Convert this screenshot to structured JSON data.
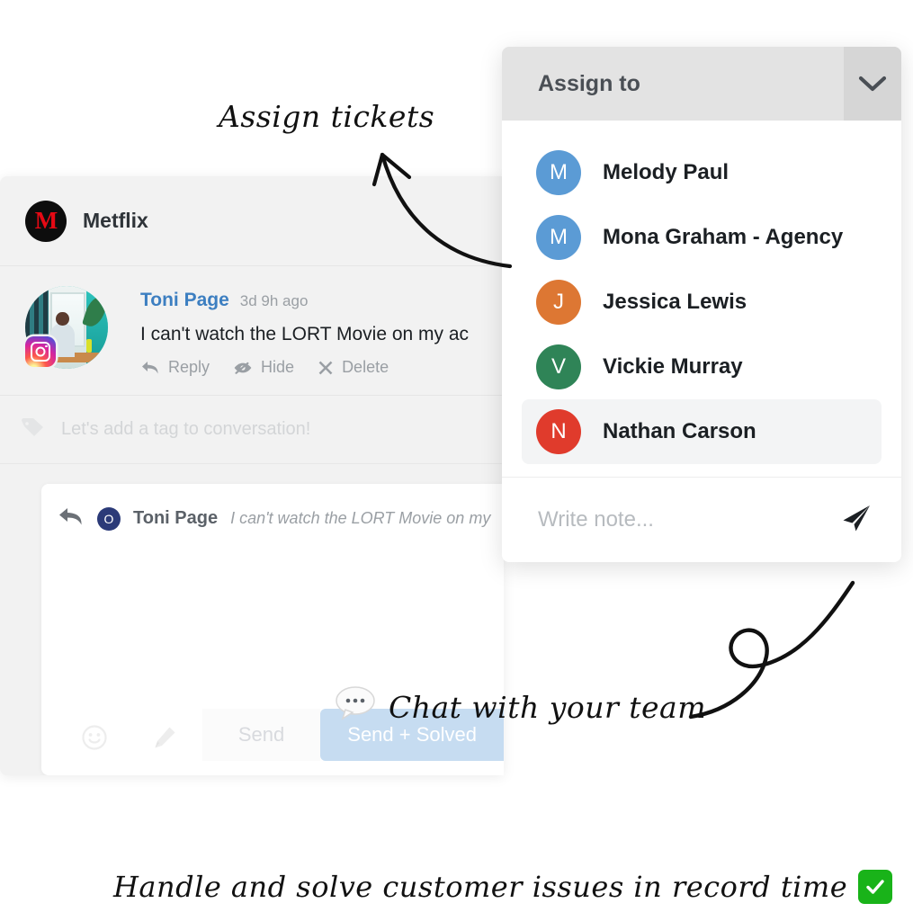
{
  "conversation": {
    "brand": {
      "logo_letter": "M",
      "name": "Metflix",
      "logo_bg": "#0d0d0d",
      "logo_color": "#e50914"
    },
    "message": {
      "author": "Toni Page",
      "author_color": "#3d7fc1",
      "timestamp": "3d 9h ago",
      "text": "I can't watch the LORT Movie on my ac",
      "channel_badge": "instagram-icon",
      "actions": [
        {
          "label": "Reply",
          "icon": "reply-arrow-icon"
        },
        {
          "label": "Hide",
          "icon": "eye-slash-icon"
        },
        {
          "label": "Delete",
          "icon": "x-mark-icon"
        }
      ]
    },
    "tag_row": {
      "icon": "tag-icon",
      "placeholder": "Let's add a tag to conversation!"
    },
    "composer": {
      "quote": {
        "reply_icon": "reply-arrow-icon",
        "avatar_letter": "O",
        "avatar_bg": "#2b3a78",
        "author": "Toni Page",
        "text": "I can't watch the LORT Movie on my "
      },
      "tools": [
        {
          "icon": "emoji-smiley-icon"
        },
        {
          "icon": "pencil-icon"
        }
      ],
      "buttons": {
        "send": "Send",
        "send_solved": "Send + Solved",
        "send_solved_bg": "#c6dcf1"
      }
    }
  },
  "assign_panel": {
    "title": "Assign to",
    "chevron_icon": "chevron-down-icon",
    "header_bg": "#e3e3e3",
    "people": [
      {
        "name": "Melody Paul",
        "initial": "M",
        "color": "#5b9bd5",
        "selected": false
      },
      {
        "name": "Mona Graham - Agency",
        "initial": "M",
        "color": "#5b9bd5",
        "selected": false
      },
      {
        "name": "Jessica Lewis",
        "initial": "J",
        "color": "#dd7733",
        "selected": false
      },
      {
        "name": "Vickie Murray",
        "initial": "V",
        "color": "#2f8457",
        "selected": false
      },
      {
        "name": "Nathan Carson",
        "initial": "N",
        "color": "#e03b2c",
        "selected": true
      }
    ],
    "note": {
      "placeholder": "Write note...",
      "send_icon": "paper-plane-icon"
    }
  },
  "annotations": {
    "assign_tickets": "Assign tickets",
    "chat_with_team": "Chat with your team",
    "chat_icon": "speech-balloon-icon",
    "caption": "Handle and solve customer issues in record time",
    "caption_emoji": "white-check-mark-icon"
  }
}
